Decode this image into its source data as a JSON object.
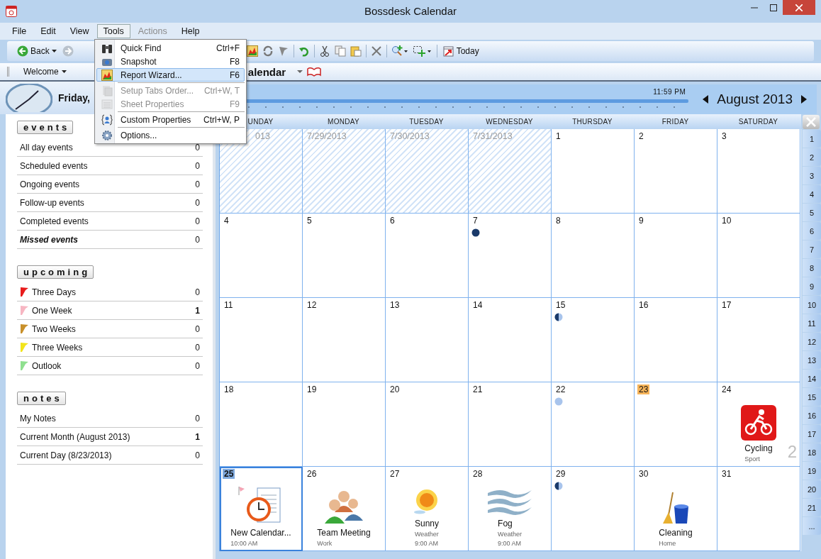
{
  "window": {
    "title": "Bossdesk Calendar"
  },
  "menu_bar": [
    {
      "label": "File",
      "selected": false,
      "disabled": false
    },
    {
      "label": "Edit",
      "selected": false,
      "disabled": false
    },
    {
      "label": "View",
      "selected": false,
      "disabled": false
    },
    {
      "label": "Tools",
      "selected": true,
      "disabled": false
    },
    {
      "label": "Actions",
      "selected": false,
      "disabled": true
    },
    {
      "label": "Help",
      "selected": false,
      "disabled": false
    }
  ],
  "tools_menu": [
    {
      "label": "Quick Find",
      "shortcut": "Ctrl+F",
      "disabled": false,
      "highlighted": false,
      "separator_after": false
    },
    {
      "label": "Snapshot",
      "shortcut": "F8",
      "disabled": false,
      "highlighted": false,
      "separator_after": false
    },
    {
      "label": "Report Wizard...",
      "shortcut": "F6",
      "disabled": false,
      "highlighted": true,
      "separator_after": true
    },
    {
      "label": "Setup Tabs Order...",
      "shortcut": "Ctrl+W, T",
      "disabled": true,
      "highlighted": false,
      "separator_after": false
    },
    {
      "label": "Sheet Properties",
      "shortcut": "F9",
      "disabled": true,
      "highlighted": false,
      "separator_after": true
    },
    {
      "label": "Custom Properties",
      "shortcut": "Ctrl+W, P",
      "disabled": false,
      "highlighted": false,
      "separator_after": true
    },
    {
      "label": "Options...",
      "disabled": false,
      "highlighted": false,
      "separator_after": false
    }
  ],
  "toolbar": {
    "back": "Back",
    "today": "Today"
  },
  "tabs": [
    {
      "label": "Welcome",
      "selected": false
    },
    {
      "label": "alendar",
      "selected": true
    }
  ],
  "date_header": "Friday,",
  "timeline": {
    "end_time": "11:59 PM",
    "month": "August 2013"
  },
  "sidebar": [
    {
      "title": "events",
      "items": [
        {
          "label": "All day events",
          "count": "0",
          "emphasis": false,
          "highlight": false
        },
        {
          "label": "Scheduled events",
          "count": "0",
          "emphasis": false,
          "highlight": false
        },
        {
          "label": "Ongoing events",
          "count": "0",
          "emphasis": false,
          "highlight": false
        },
        {
          "label": "Follow-up events",
          "count": "0",
          "emphasis": false,
          "highlight": false
        },
        {
          "label": "Completed events",
          "count": "0",
          "emphasis": false,
          "highlight": false
        },
        {
          "label": "Missed events",
          "count": "0",
          "emphasis": true,
          "highlight": false
        }
      ]
    },
    {
      "title": "upcoming",
      "items": [
        {
          "label": "Three Days",
          "count": "0",
          "emphasis": false,
          "highlight": false,
          "color": "#e81c1c"
        },
        {
          "label": "One Week",
          "count": "1",
          "emphasis": false,
          "highlight": true,
          "color": "#f7b6c2"
        },
        {
          "label": "Two Weeks",
          "count": "0",
          "emphasis": false,
          "highlight": false,
          "color": "#c8902a"
        },
        {
          "label": "Three Weeks",
          "count": "0",
          "emphasis": false,
          "highlight": false,
          "color": "#f2e41a"
        },
        {
          "label": "Outlook",
          "count": "0",
          "emphasis": false,
          "highlight": false,
          "color": "#8fe08f"
        }
      ]
    },
    {
      "title": "notes",
      "items": [
        {
          "label": "My Notes",
          "count": "0",
          "emphasis": false,
          "highlight": false
        },
        {
          "label": "Current Month (August 2013)",
          "count": "1",
          "emphasis": false,
          "highlight": true
        },
        {
          "label": "Current Day (8/23/2013)",
          "count": "0",
          "emphasis": false,
          "highlight": false
        }
      ]
    }
  ],
  "calendar": {
    "weekdays": [
      "UNDAY",
      "MONDAY",
      "TUESDAY",
      "WEDNESDAY",
      "THURSDAY",
      "FRIDAY",
      "SATURDAY"
    ],
    "week_tabs": [
      "1",
      "2",
      "3",
      "4",
      "5",
      "6",
      "7",
      "8",
      "9",
      "10",
      "11",
      "12",
      "13",
      "14",
      "15",
      "16",
      "17",
      "18",
      "19",
      "20",
      "21",
      "..."
    ],
    "days": [
      {
        "label": "013",
        "outside": true,
        "today": false,
        "selected": false
      },
      {
        "label": "7/29/2013",
        "outside": true,
        "today": false,
        "selected": false
      },
      {
        "label": "7/30/2013",
        "outside": true,
        "today": false,
        "selected": false
      },
      {
        "label": "7/31/2013",
        "outside": true,
        "today": false,
        "selected": false
      },
      {
        "label": "1",
        "outside": false,
        "today": false,
        "selected": false
      },
      {
        "label": "2",
        "outside": false,
        "today": false,
        "selected": false
      },
      {
        "label": "3",
        "outside": false,
        "today": false,
        "selected": false
      },
      {
        "label": "4",
        "outside": false,
        "today": false,
        "selected": false
      },
      {
        "label": "5",
        "outside": false,
        "today": false,
        "selected": false
      },
      {
        "label": "6",
        "outside": false,
        "today": false,
        "selected": false
      },
      {
        "label": "7",
        "outside": false,
        "today": false,
        "selected": false,
        "moon": {
          "kind": "new"
        }
      },
      {
        "label": "8",
        "outside": false,
        "today": false,
        "selected": false
      },
      {
        "label": "9",
        "outside": false,
        "today": false,
        "selected": false
      },
      {
        "label": "10",
        "outside": false,
        "today": false,
        "selected": false
      },
      {
        "label": "11",
        "outside": false,
        "today": false,
        "selected": false
      },
      {
        "label": "12",
        "outside": false,
        "today": false,
        "selected": false
      },
      {
        "label": "13",
        "outside": false,
        "today": false,
        "selected": false
      },
      {
        "label": "14",
        "outside": false,
        "today": false,
        "selected": false
      },
      {
        "label": "15",
        "outside": false,
        "today": false,
        "selected": false,
        "moon": {
          "kind": "half"
        }
      },
      {
        "label": "16",
        "outside": false,
        "today": false,
        "selected": false
      },
      {
        "label": "17",
        "outside": false,
        "today": false,
        "selected": false
      },
      {
        "label": "18",
        "outside": false,
        "today": false,
        "selected": false
      },
      {
        "label": "19",
        "outside": false,
        "today": false,
        "selected": false
      },
      {
        "label": "20",
        "outside": false,
        "today": false,
        "selected": false
      },
      {
        "label": "21",
        "outside": false,
        "today": false,
        "selected": false
      },
      {
        "label": "22",
        "outside": false,
        "today": false,
        "selected": false,
        "moon": {
          "kind": "full"
        }
      },
      {
        "label": "23",
        "outside": false,
        "today": true,
        "selected": false
      },
      {
        "label": "24",
        "outside": false,
        "today": false,
        "selected": false,
        "event": {
          "kind": "cycling",
          "title": "Cycling",
          "category": "Sport"
        },
        "overflow": "2"
      },
      {
        "label": "25",
        "outside": false,
        "today": false,
        "selected": true,
        "event": {
          "kind": "reminder",
          "title": "New Calendar...",
          "time": "10:00 AM"
        }
      },
      {
        "label": "26",
        "outside": false,
        "today": false,
        "selected": false,
        "event": {
          "kind": "meeting",
          "title": "Team Meeting",
          "category": "Work"
        }
      },
      {
        "label": "27",
        "outside": false,
        "today": false,
        "selected": false,
        "event": {
          "kind": "sunny",
          "title": "Sunny",
          "category": "Weather",
          "time": "9:00 AM"
        }
      },
      {
        "label": "28",
        "outside": false,
        "today": false,
        "selected": false,
        "event": {
          "kind": "fog",
          "title": "Fog",
          "category": "Weather",
          "time": "9:00 AM"
        }
      },
      {
        "label": "29",
        "outside": false,
        "today": false,
        "selected": false,
        "moon": {
          "kind": "half"
        }
      },
      {
        "label": "30",
        "outside": false,
        "today": false,
        "selected": false,
        "event": {
          "kind": "cleaning",
          "title": "Cleaning",
          "category": "Home"
        }
      },
      {
        "label": "31",
        "outside": false,
        "today": false,
        "selected": false
      }
    ]
  }
}
